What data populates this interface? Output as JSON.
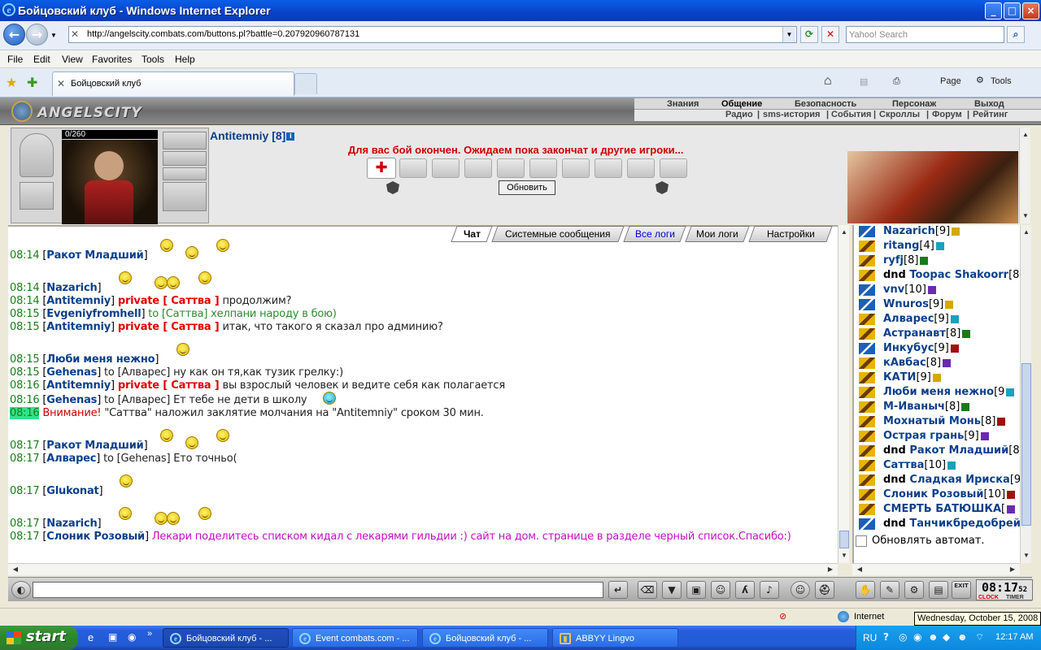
{
  "window": {
    "title": "Бойцовский клуб - Windows Internet Explorer",
    "min": "_",
    "max": "□",
    "close": "×"
  },
  "address": {
    "url": "http://angelscity.combats.com/buttons.pl?battle=0.207920960787131",
    "search_placeholder": "Yahoo! Search",
    "refresh": "⟳",
    "stop": "✕"
  },
  "menu": [
    "File",
    "Edit",
    "View",
    "Favorites",
    "Tools",
    "Help"
  ],
  "tab": {
    "title": "Бойцовский клуб"
  },
  "toolbar": {
    "page": "Page",
    "tools": "Tools"
  },
  "game": {
    "logo": "ANGELSCITY",
    "menu1": [
      "Знания",
      "Общение",
      "Безопасность",
      "Персонаж",
      "Выход"
    ],
    "menu2": [
      "Радио",
      "|",
      "sms-история",
      "|",
      "События",
      "|",
      "Скроллы",
      "|",
      "Форум",
      "|",
      "Рейтинг"
    ],
    "hp": "0/260",
    "nick": "Antitemniy [8]",
    "info": "i",
    "battle_msg": "Для вас бой окончен. Ожидаем пока закончат и другие игроки...",
    "refresh_btn": "Обновить"
  },
  "chat_tabs": [
    "Чат",
    "Системные сообщения",
    "Все логи",
    "Мои логи",
    "Настройки"
  ],
  "chat": [
    {
      "time": "08:14",
      "nick": "Ракот Младший",
      "rest": "",
      "restclass": "cf"
    },
    {
      "time": "08:14",
      "nick": "Nazarich",
      "rest": "",
      "restclass": "cf"
    },
    {
      "time": "08:14",
      "nick": "Antitemniy",
      "private": "private [ Саттва ]",
      "rest": " продолжим?",
      "restclass": "cf"
    },
    {
      "time": "08:15",
      "nick": "Evgeniyfromhell",
      "rest": " to [Саттва] хелпани народу в бою)",
      "restclass": "gr"
    },
    {
      "time": "08:15",
      "nick": "Antitemniy",
      "private": "private [ Саттва ]",
      "rest": " итак, что такого я сказал про админию?",
      "restclass": "cf"
    },
    {
      "time": "08:15",
      "nick": "Люби меня нежно",
      "rest": "",
      "restclass": "cf"
    },
    {
      "time": "08:15",
      "nick": "Gehenas",
      "rest": " to [Алварес] ну как он тя,как тузик грелку:)",
      "restclass": "cf"
    },
    {
      "time": "08:16",
      "nick": "Antitemniy",
      "private": "private [ Саттва ]",
      "rest": " вы взрослый человек и ведите себя как полагается",
      "restclass": "cf"
    },
    {
      "time": "08:16",
      "nick": "Gehenas",
      "rest": " to [Алварес] Ет тебе не дети в школу",
      "restclass": "cf"
    },
    {
      "time": "08:16",
      "warn": "Внимание!",
      "rest": " \"Саттва\" наложил заклятие молчания на \"Antitemniy\" сроком 30 мин.",
      "restclass": "cf"
    },
    {
      "time": "08:17",
      "nick": "Ракот Младший",
      "rest": "",
      "restclass": "cf"
    },
    {
      "time": "08:17",
      "nick": "Алварес",
      "rest": " to [Gehenas] Ето точньо(",
      "restclass": "cf"
    },
    {
      "time": "08:17",
      "nick": "Glukonat",
      "rest": "",
      "restclass": "cf"
    },
    {
      "time": "08:17",
      "nick": "Nazarich",
      "rest": "",
      "restclass": "cf"
    },
    {
      "time": "08:17",
      "nick": "Слоник Розовый",
      "rest": " Лекари поделитесь списком кидал с лекарями гильдии :) сайт на дом. странице в разделе черный список.Спасибо:)",
      "restclass": "mg"
    }
  ],
  "users": [
    {
      "prefix": "",
      "name": "Nazarich",
      "lvl": "[9]",
      "icon": "b"
    },
    {
      "prefix": "",
      "name": "ritang",
      "lvl": "[4]",
      "icon": "a"
    },
    {
      "prefix": "",
      "name": "ryfj",
      "lvl": "[8]",
      "icon": "a"
    },
    {
      "prefix": "dnd ",
      "name": "Toopac Shakoorr",
      "lvl": "[8]",
      "icon": "a"
    },
    {
      "prefix": "",
      "name": "vnv",
      "lvl": "[10]",
      "icon": "b"
    },
    {
      "prefix": "",
      "name": "Wnuros",
      "lvl": "[9]",
      "icon": "b"
    },
    {
      "prefix": "",
      "name": "Алварес",
      "lvl": "[9]",
      "icon": "a"
    },
    {
      "prefix": "",
      "name": "Астранавт",
      "lvl": "[8]",
      "icon": "a"
    },
    {
      "prefix": "",
      "name": "Инкубус",
      "lvl": "[9]",
      "icon": "b"
    },
    {
      "prefix": "",
      "name": "кАвбас",
      "lvl": "[8]",
      "icon": "a"
    },
    {
      "prefix": "",
      "name": "КАТИ",
      "lvl": "[9]",
      "icon": "a"
    },
    {
      "prefix": "",
      "name": "Люби меня нежно",
      "lvl": "[9",
      "icon": "a"
    },
    {
      "prefix": "",
      "name": "М-Иваныч",
      "lvl": "[8]",
      "icon": "a"
    },
    {
      "prefix": "",
      "name": "Мохнатый Монь",
      "lvl": "[8]",
      "icon": "a"
    },
    {
      "prefix": "",
      "name": "Острая грань",
      "lvl": "[9]",
      "icon": "a"
    },
    {
      "prefix": "dnd ",
      "name": "Ракот Младший",
      "lvl": "[8]",
      "icon": "a"
    },
    {
      "prefix": "",
      "name": "Саттва",
      "lvl": "[10]",
      "icon": "a"
    },
    {
      "prefix": "dnd ",
      "name": "Сладкая Ириска",
      "lvl": "[9]",
      "icon": "a"
    },
    {
      "prefix": "",
      "name": "Слоник Розовый",
      "lvl": "[10]",
      "icon": "a"
    },
    {
      "prefix": "",
      "name": "СМЕРТЬ БАТЮШКА",
      "lvl": "[",
      "icon": "a"
    },
    {
      "prefix": "dnd ",
      "name": "Танчикбредобрей",
      "lvl": "[",
      "icon": "b"
    }
  ],
  "autoupdate": "Обновлять автомат.",
  "clock": {
    "time": "08:17",
    "sec": "52",
    "clock_label": "CLOCK",
    "timer_label": "TIMER"
  },
  "status": {
    "zone": "Internet",
    "tooltip": "Wednesday, October 15, 2008"
  },
  "taskbar": {
    "start": "start",
    "tasks": [
      "Бойцовский клуб - ...",
      "Event combats.com - ...",
      "Бойцовский клуб - ...",
      "ABBYY Lingvo"
    ],
    "lang": "RU",
    "time": "12:17 AM"
  },
  "colors": {
    "titlebar": "#0a4fd8",
    "nick": "#0b3f8a",
    "private": "#e00000",
    "time": "#1a7d1a",
    "highlight": "#2ee48a"
  }
}
